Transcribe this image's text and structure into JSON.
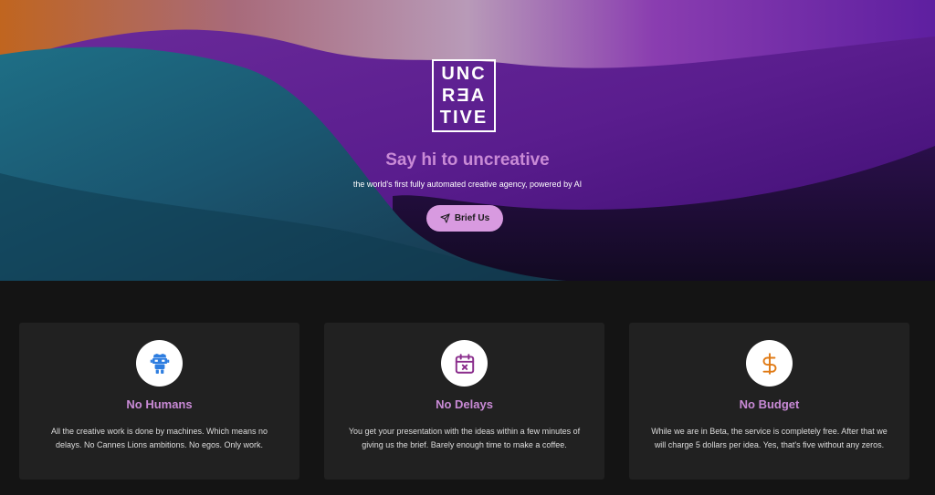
{
  "hero": {
    "logo_lines": [
      "UNC",
      "RƎA",
      "TIVE"
    ],
    "headline": "Say hi to uncreative",
    "tagline": "the world's first fully automated creative agency, powered by AI",
    "cta_label": "Brief Us",
    "cta_icon": "send-icon"
  },
  "features": [
    {
      "icon": "robot-icon",
      "title": "No Humans",
      "description": "All the creative work is done by machines. Which means no delays. No Cannes Lions ambitions. No egos. Only work."
    },
    {
      "icon": "calendar-x-icon",
      "title": "No Delays",
      "description": "You get your presentation with the ideas within a few minutes of giving us the brief. Barely enough time to make a coffee."
    },
    {
      "icon": "dollar-icon",
      "title": "No Budget",
      "description": "While we are in Beta, the service is completely free. After that we will charge 5 dollars per idea. Yes, that's five without any zeros."
    }
  ],
  "colors": {
    "accent": "#c98ad6",
    "button_bg": "#d89ae0",
    "card_bg": "#212121",
    "page_bg": "#141414",
    "icon_blue": "#2d7de0",
    "icon_purple": "#8a2d8c",
    "icon_orange": "#e07b16"
  }
}
